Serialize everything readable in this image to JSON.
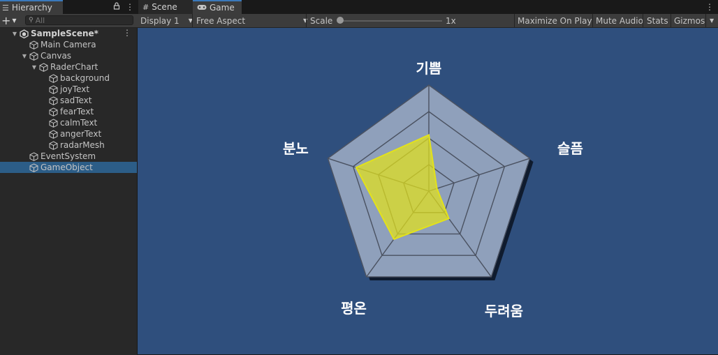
{
  "hierarchy": {
    "tab_label": "Hierarchy",
    "search_placeholder": "All",
    "rows": [
      {
        "label": "SampleScene*",
        "kind": "scene",
        "indent": 0,
        "arrow": "▼"
      },
      {
        "label": "Main Camera",
        "kind": "obj",
        "indent": 1,
        "arrow": ""
      },
      {
        "label": "Canvas",
        "kind": "obj",
        "indent": 1,
        "arrow": "▼"
      },
      {
        "label": "RaderChart",
        "kind": "obj",
        "indent": 2,
        "arrow": "▼"
      },
      {
        "label": "background",
        "kind": "obj",
        "indent": 3,
        "arrow": ""
      },
      {
        "label": "joyText",
        "kind": "obj",
        "indent": 3,
        "arrow": ""
      },
      {
        "label": "sadText",
        "kind": "obj",
        "indent": 3,
        "arrow": ""
      },
      {
        "label": "fearText",
        "kind": "obj",
        "indent": 3,
        "arrow": ""
      },
      {
        "label": "calmText",
        "kind": "obj",
        "indent": 3,
        "arrow": ""
      },
      {
        "label": "angerText",
        "kind": "obj",
        "indent": 3,
        "arrow": ""
      },
      {
        "label": "radarMesh",
        "kind": "obj",
        "indent": 3,
        "arrow": ""
      },
      {
        "label": "EventSystem",
        "kind": "obj",
        "indent": 1,
        "arrow": ""
      },
      {
        "label": "GameObject",
        "kind": "obj",
        "indent": 1,
        "arrow": "",
        "selected": true
      }
    ]
  },
  "tabs": {
    "scene_label": "Scene",
    "game_label": "Game"
  },
  "toolbar": {
    "display": "Display 1",
    "aspect": "Free Aspect",
    "scale_label": "Scale",
    "scale_value": "1x",
    "scale_level": 0,
    "maximize": "Maximize On Play",
    "mute": "Mute Audio",
    "stats": "Stats",
    "gizmos": "Gizmos"
  },
  "colors": {
    "viewport_bg": "#2f4f7d",
    "pentagon_fill": "#8fa0bb",
    "grid_line": "#4a5160",
    "data_fill": "#e3e21a",
    "selection": "#2c5d87",
    "accent_tab": "#3a79bb"
  },
  "radar": {
    "axes": [
      "기쁨",
      "슬픔",
      "두려움",
      "평온",
      "분노"
    ],
    "values": [
      0.53,
      0.08,
      0.32,
      0.56,
      0.72
    ],
    "rings": 4,
    "max": 1.0
  }
}
